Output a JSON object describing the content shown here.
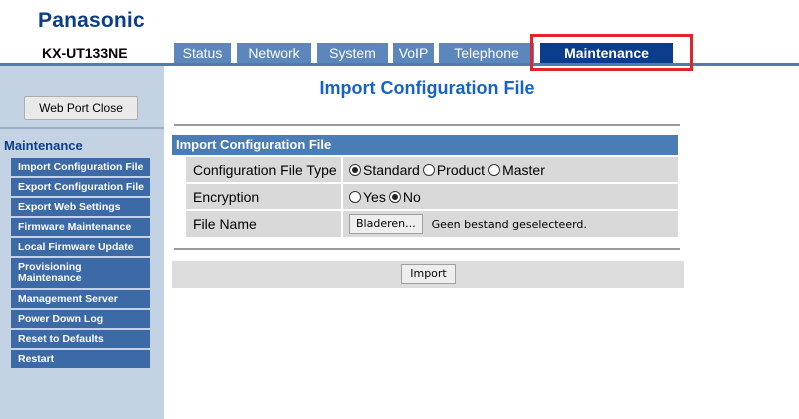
{
  "header": {
    "brand": "Panasonic",
    "model": "KX-UT133NE",
    "tabs": [
      {
        "label": "Status",
        "active": false
      },
      {
        "label": "Network",
        "active": false
      },
      {
        "label": "System",
        "active": false
      },
      {
        "label": "VoIP",
        "active": false
      },
      {
        "label": "Telephone",
        "active": false
      },
      {
        "label": "Maintenance",
        "active": true
      }
    ]
  },
  "sidebar": {
    "port_button": "Web Port Close",
    "heading": "Maintenance",
    "items": [
      {
        "label": "Import Configuration File"
      },
      {
        "label": "Export Configuration File"
      },
      {
        "label": "Export Web Settings"
      },
      {
        "label": "Firmware Maintenance"
      },
      {
        "label": "Local Firmware Update"
      },
      {
        "label": "Provisioning Maintenance"
      },
      {
        "label": "Management Server"
      },
      {
        "label": "Power Down Log"
      },
      {
        "label": "Reset to Defaults"
      },
      {
        "label": "Restart"
      }
    ]
  },
  "main": {
    "title": "Import Configuration File",
    "section_title": "Import Configuration File",
    "config_type": {
      "label": "Configuration File Type",
      "options": [
        "Standard",
        "Product",
        "Master"
      ],
      "selected": "Standard"
    },
    "encryption": {
      "label": "Encryption",
      "options": [
        "Yes",
        "No"
      ],
      "selected": "No"
    },
    "file_name": {
      "label": "File Name",
      "browse_label": "Bladeren...",
      "status": "Geen bestand geselecteerd."
    },
    "import_label": "Import"
  },
  "colors": {
    "brand": "#0b3e8a",
    "tab": "#5b87bd",
    "tab_active": "#0a3d8c",
    "highlight": "#e0262a",
    "sidebar_bg": "#c4d3e4",
    "sidebar_item": "#3b6aa6",
    "title": "#1563c8"
  }
}
